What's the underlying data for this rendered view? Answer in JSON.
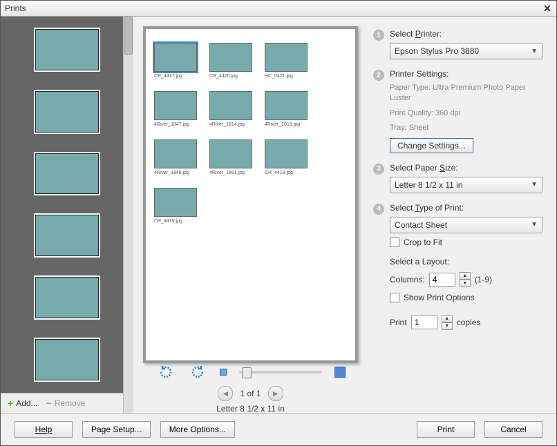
{
  "window": {
    "title": "Prints"
  },
  "thumbstrip": {
    "items": [
      {},
      {},
      {},
      {},
      {},
      {}
    ],
    "add_label": "Add...",
    "remove_label": "Remove"
  },
  "preview": {
    "items": [
      {
        "caption": "CR_4417.jpg",
        "selected": true
      },
      {
        "caption": "CR_4420.jpg"
      },
      {
        "caption": "HC_0421.jpg"
      },
      {
        "caption": "4River_1847.jpg"
      },
      {
        "caption": "4River_1814.jpg"
      },
      {
        "caption": "4River_1816.jpg"
      },
      {
        "caption": "4River_1848.jpg"
      },
      {
        "caption": "4River_1851.jpg"
      },
      {
        "caption": "CR_4418.jpg"
      },
      {
        "caption": "CR_4419.jpg"
      }
    ],
    "pager_text": "1 of 1",
    "page_size_text": "Letter 8 1/2 x 11 in"
  },
  "settings": {
    "step1": {
      "label_pre": "Select ",
      "label_u": "P",
      "label_post": "rinter:",
      "value": "Epson Stylus Pro 3880"
    },
    "step2": {
      "label": "Printer Settings:",
      "line1": "Paper Type: Ultra Premium Photo Paper Luster",
      "line2": "Print Quality: 360 dpi",
      "line3": "Tray: Sheet",
      "button": "Change Settings..."
    },
    "step3": {
      "label_pre": "Select Paper ",
      "label_u": "S",
      "label_post": "ize:",
      "value": "Letter 8 1/2 x 11 in"
    },
    "step4": {
      "label_pre": "Select ",
      "label_u": "T",
      "label_post": "ype of Print:",
      "value": "Contact Sheet",
      "crop_label": "Crop to Fit"
    },
    "layout": {
      "heading": "Select a Layout:",
      "columns_label": "Columns:",
      "columns_value": "4",
      "columns_range": "(1-9)",
      "show_options_label": "Show Print Options",
      "print_label": "Print",
      "copies_value": "1",
      "copies_label": "copies"
    }
  },
  "footer": {
    "help": "Help",
    "page_setup": "Page Setup...",
    "more_options": "More Options...",
    "print": "Print",
    "cancel": "Cancel"
  }
}
